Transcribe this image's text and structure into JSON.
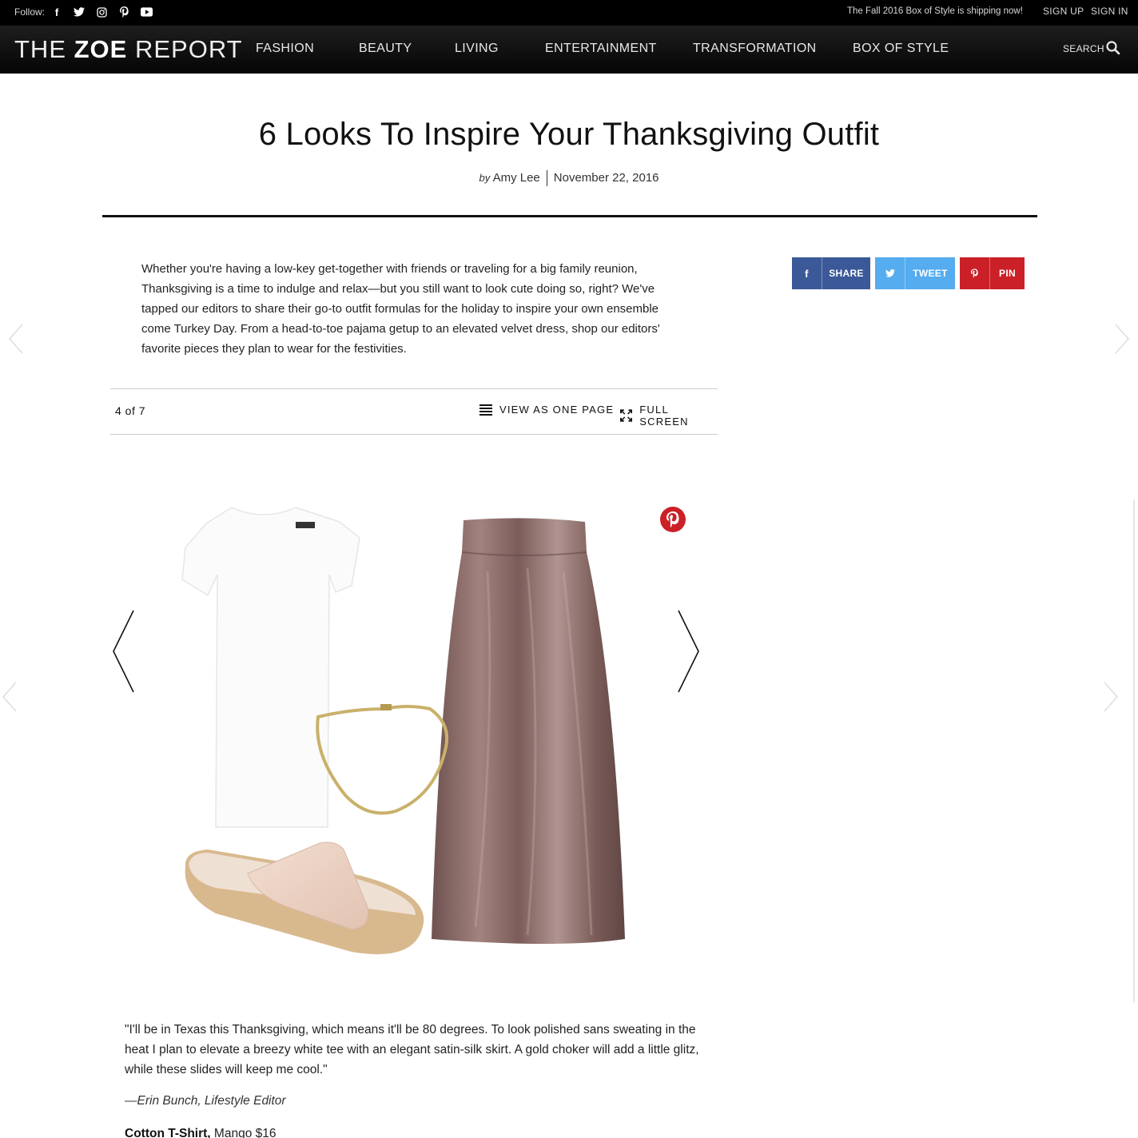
{
  "topbar": {
    "follow_label": "Follow:",
    "social_icons": [
      "facebook-icon",
      "twitter-icon",
      "instagram-icon",
      "pinterest-icon",
      "youtube-icon"
    ],
    "promo": "The Fall 2016 Box of Style is shipping now!",
    "sign_up": "SIGN UP",
    "sign_in": "SIGN IN"
  },
  "nav": {
    "logo_light": "THE ",
    "logo_bold": "ZOE",
    "logo_light2": " REPORT",
    "items": [
      "FASHION",
      "BEAUTY",
      "LIVING",
      "ENTERTAINMENT",
      "TRANSFORMATION",
      "BOX OF STYLE"
    ],
    "search_label": "SEARCH"
  },
  "article": {
    "title": "6 Looks To Inspire Your Thanksgiving Outfit",
    "by": "by",
    "author": "Amy Lee",
    "date": "November 22, 2016",
    "intro": "Whether you're having a low-key get-together with friends or traveling for a big family reunion, Thanksgiving is a time to indulge and relax—but you still want to look cute doing so, right? We've tapped our editors to share their go-to outfit formulas for the holiday to inspire your own ensemble come Turkey Day. From a head-to-toe pajama getup to an elevated velvet dress, shop our editors' favorite pieces they plan to wear for the festivities."
  },
  "share": {
    "facebook": "SHARE",
    "twitter": "TWEET",
    "pinterest": "PIN",
    "colors": {
      "facebook": "#3b5998",
      "twitter": "#55acee",
      "pinterest": "#cb2027"
    }
  },
  "slideshow": {
    "counter": "4 of 7",
    "view_one_page": "VIEW AS ONE PAGE",
    "full_screen": "FULL SCREEN"
  },
  "slide": {
    "quote": "\"I'll be in Texas this Thanksgiving, which means it'll be 80 degrees. To look polished sans sweating in the heat I plan to elevate a breezy white tee with an elegant satin-silk skirt. A gold choker will add a little glitz, while these slides will keep me cool.\"",
    "attribution": "—Erin Bunch, Lifestyle Editor",
    "product_name": "Cotton T-Shirt,",
    "product_detail": " Mango $16"
  }
}
